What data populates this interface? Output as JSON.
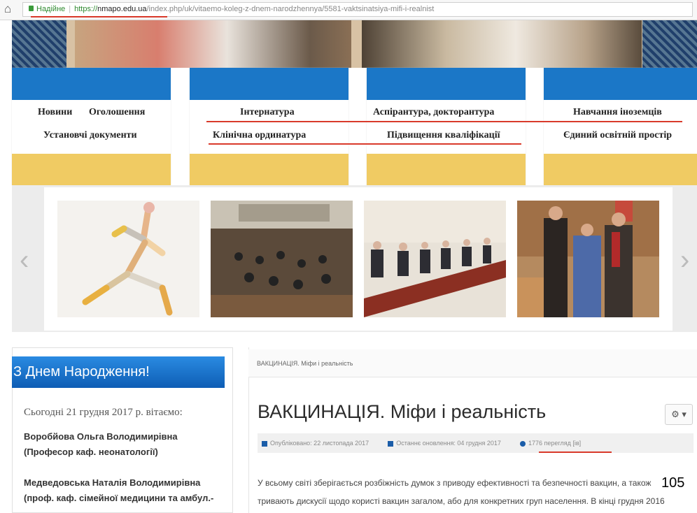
{
  "browser": {
    "secure_label": "Надійне",
    "url_protocol": "https://",
    "url_host": "nmapo.edu.ua",
    "url_path": "/index.php/uk/vitaemo-koleg-z-dnem-narodzhennya/5581-vaktsinatsiya-mifi-i-realnist"
  },
  "nav": {
    "col1": [
      "Новини",
      "Оголошення",
      "Установчі документи"
    ],
    "col2": [
      "Інтернатура",
      "Клінічна ординатура"
    ],
    "col3": [
      "Аспірантура, докторантура",
      "Підвищення кваліфікації"
    ],
    "col4": [
      "Навчання іноземців",
      "Єдиний освітній простір"
    ]
  },
  "sidebar": {
    "heading": "З Днем Народження!",
    "today": "Сьогодні 21 грудня 2017 р. вітаємо:",
    "people": [
      {
        "line1": "Воробйова Ольга Володимирівна",
        "line2": "(Професор каф. неонатології)"
      },
      {
        "line1": "Медведовська Наталія Володимирівна",
        "line2": "(проф. каф. сімейної медицини та амбул.-"
      }
    ]
  },
  "article": {
    "breadcrumb": "ВАКЦИНАЦІЯ. Міфи і реальність",
    "title": "ВАКЦИНАЦІЯ. Міфи і реальність",
    "gear_label": "⚙ ▾",
    "published": "Опубліковано: 22 листопада 2017",
    "updated": "Останнє оновлення: 04 грудня 2017",
    "views": "1776 перегляд [ів]",
    "body_line1": "У всьому світі зберігається розбіжність думок з приводу ефективності та безпечності вакцин, а також",
    "body_line2": "тривають дискусії щодо користі вакцин загалом, або для конкретних груп населення. В кінці грудня 2016"
  },
  "slide_number": "105",
  "colors": {
    "nav_blue": "#1b77c7",
    "nav_gold": "#f0cb63",
    "annotation_red": "#d93a2b"
  }
}
